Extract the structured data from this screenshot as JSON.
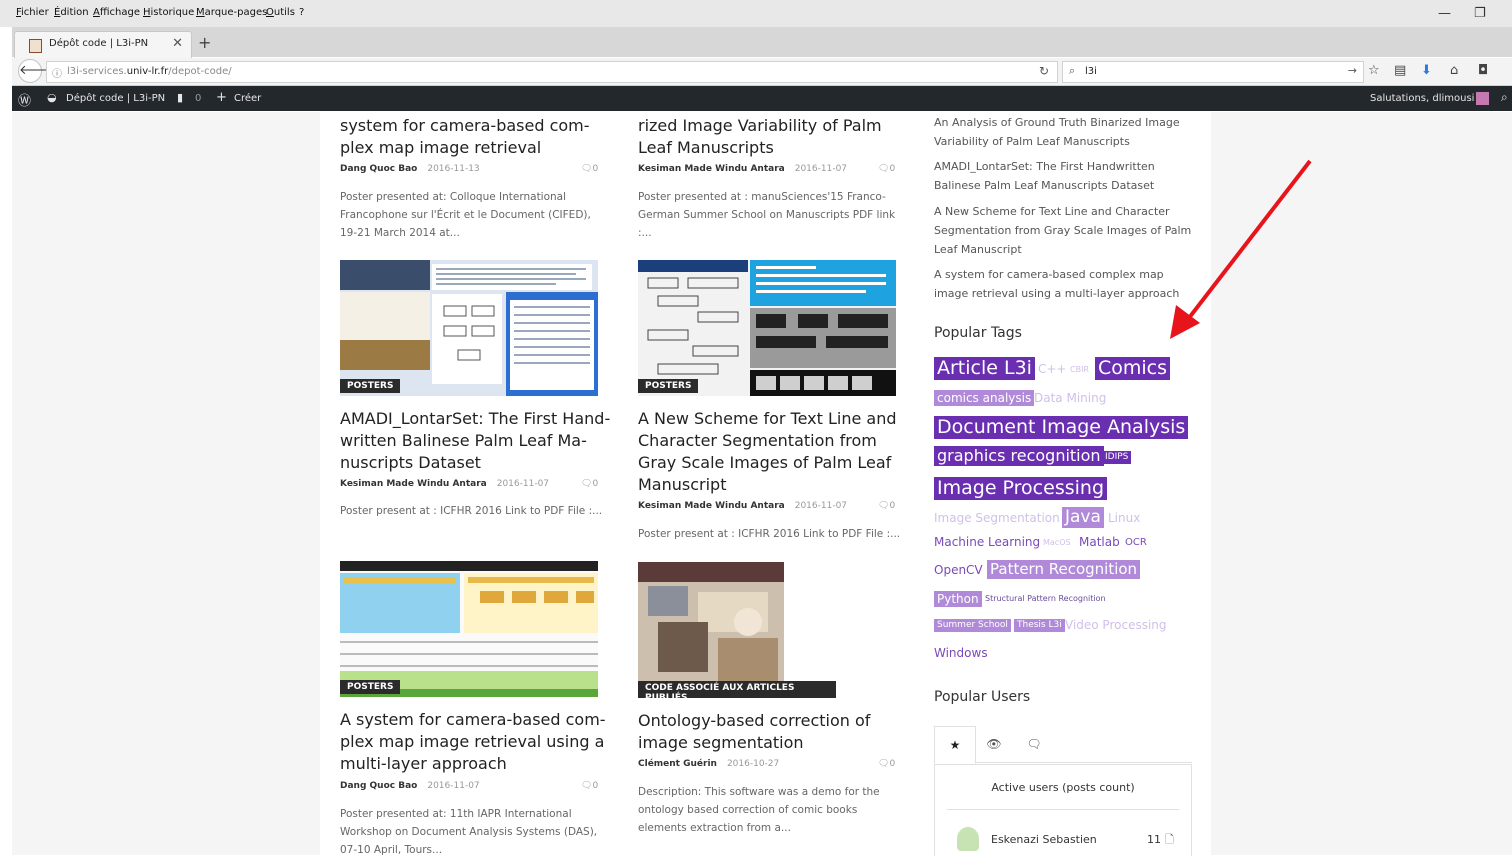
{
  "browser": {
    "menu": [
      "Fichier",
      "Édition",
      "Affichage",
      "Historique",
      "Marque-pages",
      "Outils",
      "?"
    ],
    "tab_title": "Dépôt code | L3i-PN",
    "url_prefix": "l3i-services.",
    "url_domain": "univ-lr.fr",
    "url_path": "/depot-code/",
    "search_query": "l3i"
  },
  "admin_bar": {
    "site_name": "Dépôt code | L3i-PN",
    "comments_count": "0",
    "new_label": "Créer",
    "greeting": "Salutations, dlimousi"
  },
  "posts": [
    {
      "title_lines": [
        "system for camera-based com-",
        "plex map image retrieval"
      ],
      "author": "Dang Quoc Bao",
      "date": "2016-11-13",
      "comments": "0",
      "excerpt_lines": [
        "Poster presented at: Colloque International",
        "Francophone sur l'Écrit et le Document (CIFED),",
        "19-21 March 2014 at..."
      ]
    },
    {
      "title_lines": [
        "rized Image Variability of Palm",
        "Leaf Manuscripts"
      ],
      "author": "Kesiman Made Windu Antara",
      "date": "2016-11-07",
      "comments": "0",
      "excerpt_lines": [
        "Poster presented at : manuSciences'15 Franco-",
        "German Summer School on Manuscripts PDF link",
        ":..."
      ]
    },
    {
      "category": "POSTERS",
      "title_lines": [
        "AMADI_LontarSet: The First Hand-",
        "written Balinese Palm Leaf Ma-",
        "nuscripts Dataset"
      ],
      "author": "Kesiman Made Windu Antara",
      "date": "2016-11-07",
      "comments": "0",
      "excerpt_lines": [
        "Poster present at : ICFHR 2016 Link to PDF File :..."
      ]
    },
    {
      "category": "POSTERS",
      "title_lines": [
        "A New Scheme for Text Line and",
        "Character Segmentation from",
        "Gray Scale Images of Palm Leaf",
        "Manuscript"
      ],
      "author": "Kesiman Made Windu Antara",
      "date": "2016-11-07",
      "comments": "0",
      "excerpt_lines": [
        "Poster present at : ICFHR 2016 Link to PDF File :..."
      ]
    },
    {
      "category": "POSTERS",
      "title_lines": [
        "A system for camera-based com-",
        "plex map image retrieval using a",
        "multi-layer approach"
      ],
      "author": "Dang Quoc Bao",
      "date": "2016-11-07",
      "comments": "0",
      "excerpt_lines": [
        " Poster presented at: 11th IAPR International",
        "Workshop on Document Analysis Systems (DAS),",
        "07-10 April, Tours..."
      ]
    },
    {
      "category": "CODE ASSOCIÉ AUX ARTICLES PUBLIÉS",
      "title_lines": [
        "Ontology-based correction of",
        "image segmentation"
      ],
      "author": "Clément Guérin",
      "date": "2016-10-27",
      "comments": "0",
      "excerpt_lines": [
        "Description: This software was a demo for the",
        "ontology based correction of comic books",
        "elements extraction from a..."
      ]
    }
  ],
  "sidebar": {
    "recent_lines": [
      [
        "An Analysis of Ground Truth Binarized Image",
        "Variability of Palm Leaf Manuscripts"
      ],
      [
        "AMADI_LontarSet: The First Handwritten",
        "Balinese Palm Leaf Manuscripts Dataset"
      ],
      [
        "A New Scheme for Text Line and Character",
        "Segmentation from Gray Scale Images of Palm",
        "Leaf Manuscript"
      ],
      [
        "A system for camera-based complex map",
        "image retrieval using a multi-layer approach"
      ]
    ],
    "popular_tags_title": "Popular Tags",
    "tags": {
      "article_l3i": "Article L3i",
      "cpp": "C++",
      "cbir": "CBIR",
      "comics": "Comics",
      "comics_analysis": "comics analysis",
      "data_mining": "Data Mining",
      "document_image_analysis": "Document Image Analysis",
      "graphics_recognition": "graphics recognition",
      "idips": "IDIPS",
      "image_processing": "Image Processing",
      "image_segmentation": "Image Segmentation",
      "java": "Java",
      "linux": "Linux",
      "machine_learning": "Machine Learning",
      "macos": "MacOS",
      "matlab": "Matlab",
      "ocr": "OCR",
      "opencv": "OpenCV",
      "pattern_recognition": "Pattern Recognition",
      "python": "Python",
      "structural_pattern_recognition": "Structural Pattern Recognition",
      "summer_school": "Summer School",
      "thesis_l3i": "Thesis L3i",
      "video_processing": "Video Processing",
      "windows": "Windows"
    },
    "popular_users_title": "Popular Users",
    "users_heading": "Active users (posts count)",
    "user_name": "Eskenazi Sebastien",
    "user_count": "11"
  },
  "colors": {
    "tag_strong": "#6a2fb0",
    "tag_mid": "#b08ad8",
    "annotation_arrow": "#e8141b"
  }
}
